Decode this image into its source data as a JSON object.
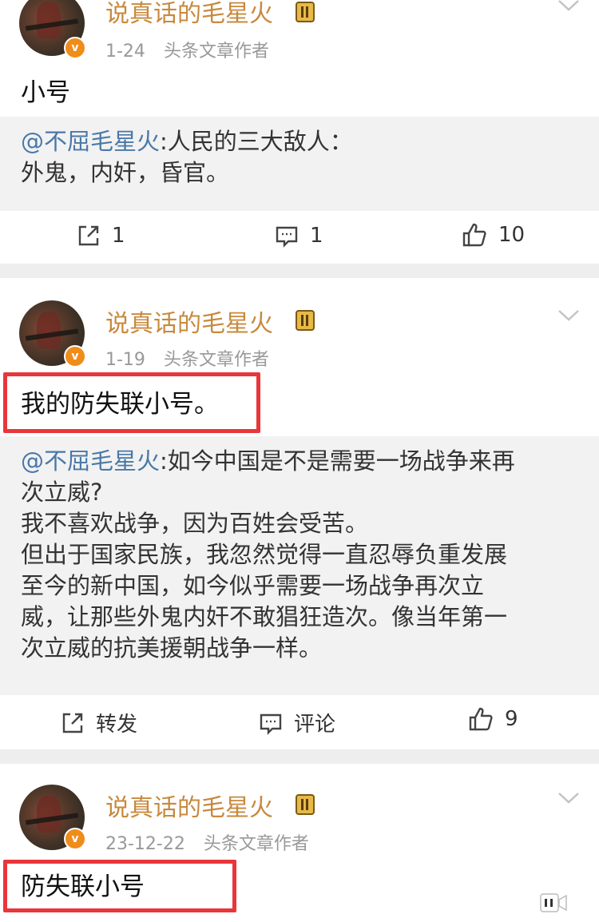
{
  "posts": [
    {
      "username": "说真话的毛星火",
      "date": "1-24",
      "role": "头条文章作者",
      "text": "小号",
      "quote": {
        "mention": "@不屈毛星火",
        "lines": [
          ":人民的三大敌人：",
          "外鬼，内奸，昏官。"
        ]
      },
      "actions": {
        "share": "1",
        "comment": "1",
        "like": "10"
      }
    },
    {
      "username": "说真话的毛星火",
      "date": "1-19",
      "role": "头条文章作者",
      "text": "我的防失联小号。",
      "quote": {
        "mention": "@不屈毛星火",
        "lines": [
          ":如今中国是不是需要一场战争来再",
          "次立威?",
          "我不喜欢战争，因为百姓会受苦。",
          "但出于国家民族，我忽然觉得一直忍辱负重发展",
          "至今的新中国，如今似乎需要一场战争再次立",
          "威，让那些外鬼内奸不敢猖狂造次。像当年第一",
          "次立威的抗美援朝战争一样。"
        ]
      },
      "actions": {
        "share": "转发",
        "comment": "评论",
        "like": "9"
      }
    },
    {
      "username": "说真话的毛星火",
      "date": "23-12-22",
      "role": "头条文章作者",
      "text": "防失联小号"
    }
  ],
  "colors": {
    "username": "#c8893d",
    "mention": "#4a78a8",
    "highlight_box": "#e8363b",
    "quote_bg": "#f2f2f2",
    "verified_badge": "#f08c1a"
  },
  "icons": {
    "share": "share-icon",
    "comment": "comment-icon",
    "like": "thumbs-up-icon",
    "more": "chevron-down-icon",
    "verified": "verified-v-icon",
    "level": "level-badge-icon"
  }
}
